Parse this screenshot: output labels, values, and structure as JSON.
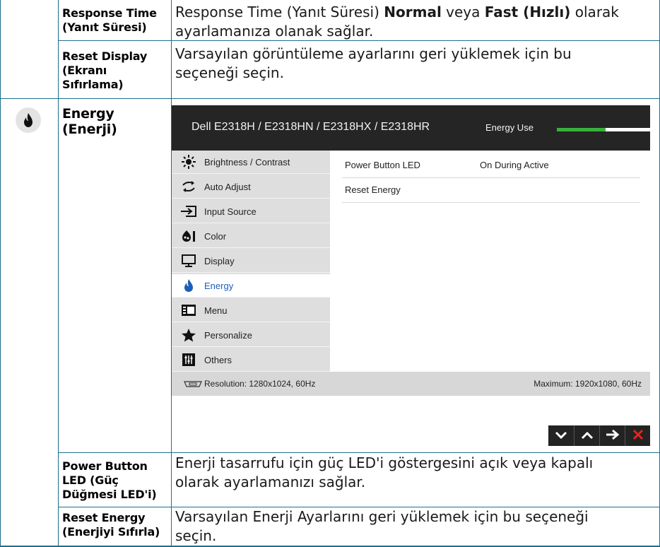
{
  "rows": {
    "response_time": {
      "term_line1": "Response Time",
      "term_line2": "(Yanıt Süresi)",
      "desc_line1_a": "Response Time (Yanıt Süresi) ",
      "desc_line1_b": "Normal",
      "desc_line1_c": " veya ",
      "desc_line1_d": "Fast (Hızlı)",
      "desc_line1_e": " olarak",
      "desc_line2": "ayarlamanıza olanak sağlar."
    },
    "reset_display": {
      "term_line1": "Reset Display",
      "term_line2": "(Ekranı",
      "term_line3": "Sıfırlama)",
      "desc_line1": "Varsayılan görüntüleme ayarlarını geri yüklemek için bu",
      "desc_line2": "seçeneği seçin."
    },
    "energy": {
      "icon": "energy-flame-icon",
      "term_line1": "Energy",
      "term_line2": "(Enerji)"
    },
    "power_button_led": {
      "term_line1": "Power Button",
      "term_line2": "LED (Güç",
      "term_line3": "Düğmesi LED'i)",
      "desc_line1": "Enerji tasarrufu için güç LED'i göstergesini açık veya kapalı",
      "desc_line2": "olarak ayarlamanızı sağlar."
    },
    "reset_energy": {
      "term_line1": "Reset Energy",
      "term_line2": "(Enerjiyi Sıfırla)",
      "desc_line1": "Varsayılan Enerji Ayarlarını geri yüklemek için bu seçeneği",
      "desc_line2": "seçin."
    }
  },
  "osd": {
    "title": "Dell E2318H / E2318HN / E2318HX / E2318HR",
    "energy_use_label": "Energy Use",
    "energy_use_level": 0.52,
    "menu": [
      {
        "label": "Brightness / Contrast",
        "icon": "brightness-icon",
        "active": false
      },
      {
        "label": "Auto Adjust",
        "icon": "auto-adjust-icon",
        "active": false
      },
      {
        "label": "Input Source",
        "icon": "input-source-icon",
        "active": false
      },
      {
        "label": "Color",
        "icon": "color-icon",
        "active": false
      },
      {
        "label": "Display",
        "icon": "display-icon",
        "active": false
      },
      {
        "label": "Energy",
        "icon": "energy-icon",
        "active": true
      },
      {
        "label": "Menu",
        "icon": "menu-icon",
        "active": false
      },
      {
        "label": "Personalize",
        "icon": "star-icon",
        "active": false
      },
      {
        "label": "Others",
        "icon": "others-icon",
        "active": false
      }
    ],
    "options": [
      {
        "label": "Power Button LED",
        "value": "On During Active"
      },
      {
        "label": "Reset Energy",
        "value": ""
      }
    ],
    "footer": {
      "resolution": "Resolution: 1280x1024, 60Hz",
      "maximum": "Maximum: 1920x1080, 60Hz"
    },
    "nav_buttons": [
      "chevron-down-icon",
      "chevron-up-icon",
      "arrow-right-icon",
      "close-icon"
    ],
    "colors": {
      "header_bg": "#252525",
      "energy_bar": "#39b13d",
      "close_x": "#e8221b",
      "active_label": "#1c5fb8"
    }
  }
}
